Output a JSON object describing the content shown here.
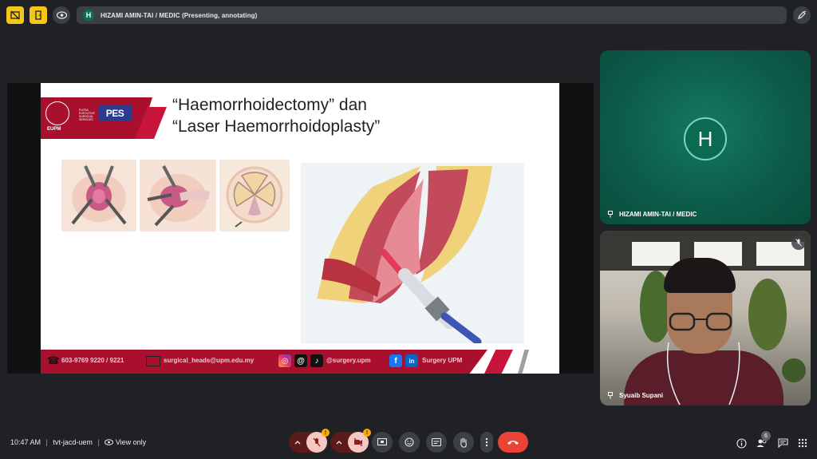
{
  "presenter_bar": {
    "avatar_letter": "H",
    "text": "HIZAMI AMIN-TAI / MEDIC (Presenting, annotating)"
  },
  "slide": {
    "title_line1": "“Haemorrhoidectomy” dan",
    "title_line2": "“Laser Haemorrhoidoplasty”",
    "header": {
      "seal_label": "EUPM",
      "pes_small": "PUTRA EXECUTIVE SURGICAL SERVICES",
      "pes_logo": "PES"
    },
    "footer": {
      "phone": "603-9769 9220 / 9221",
      "email": "surgical_heads@upm.edu.my",
      "social_handle": "@surgery.upm",
      "fb_li_name": "Surgery UPM"
    }
  },
  "participants": [
    {
      "name": "HIZAMI AMIN-TAI / MEDIC",
      "avatar_letter": "H",
      "tile_color": "#0c5a48"
    },
    {
      "name": "Syuaib Supani"
    }
  ],
  "bottom_bar": {
    "time": "10:47 AM",
    "meeting_code": "tvt-jacd-uem",
    "view_mode": "View only",
    "participant_count": "6",
    "warning_mark": "!"
  },
  "colors": {
    "slide_red": "#a8102e",
    "end_call": "#ea4335",
    "presenter_green": "#0b6e58",
    "warning": "#f9ab00"
  }
}
